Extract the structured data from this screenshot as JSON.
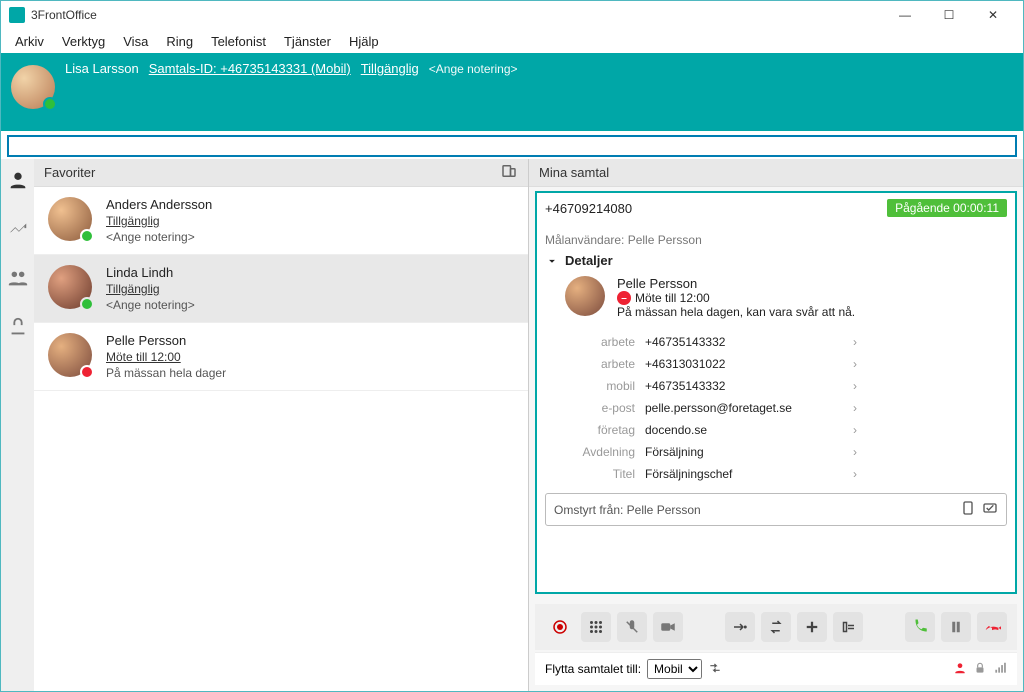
{
  "window": {
    "title": "3FrontOffice"
  },
  "menu": [
    "Arkiv",
    "Verktyg",
    "Visa",
    "Ring",
    "Telefonist",
    "Tjänster",
    "Hjälp"
  ],
  "user": {
    "name": "Lisa Larsson",
    "caller_id": "Samtals-ID: +46735143331 (Mobil)",
    "status": "Tillgänglig",
    "note_placeholder": "<Ange notering>"
  },
  "left": {
    "header": "Favoriter",
    "items": [
      {
        "name": "Anders Andersson",
        "status": "Tillgänglig",
        "note": "<Ange notering>",
        "presence": "green"
      },
      {
        "name": "Linda Lindh",
        "status": "Tillgänglig",
        "note": "<Ange notering>",
        "presence": "green"
      },
      {
        "name": "Pelle Persson",
        "status": "Möte till 12:00",
        "note": "På mässan hela dager",
        "presence": "red"
      }
    ]
  },
  "right": {
    "header": "Mina samtal",
    "call_number": "+46709214080",
    "call_badge": "Pågående 00:00:11",
    "target_label": "Målanvändare: Pelle Persson",
    "details_label": "Detaljer",
    "person": {
      "name": "Pelle Persson",
      "status": "Möte till 12:00",
      "note": "På mässan hela dagen, kan vara svår att nå."
    },
    "fields": [
      {
        "label": "arbete",
        "value": "+46735143332"
      },
      {
        "label": "arbete",
        "value": "+46313031022"
      },
      {
        "label": "mobil",
        "value": "+46735143332"
      },
      {
        "label": "e-post",
        "value": "pelle.persson@foretaget.se"
      },
      {
        "label": "företag",
        "value": "docendo.se"
      },
      {
        "label": "Avdelning",
        "value": "Försäljning"
      },
      {
        "label": "Titel",
        "value": "Försäljningschef"
      }
    ],
    "redirect": "Omstyrt från: Pelle Persson",
    "move_label": "Flytta samtalet till:",
    "move_options": [
      "Mobil"
    ]
  }
}
